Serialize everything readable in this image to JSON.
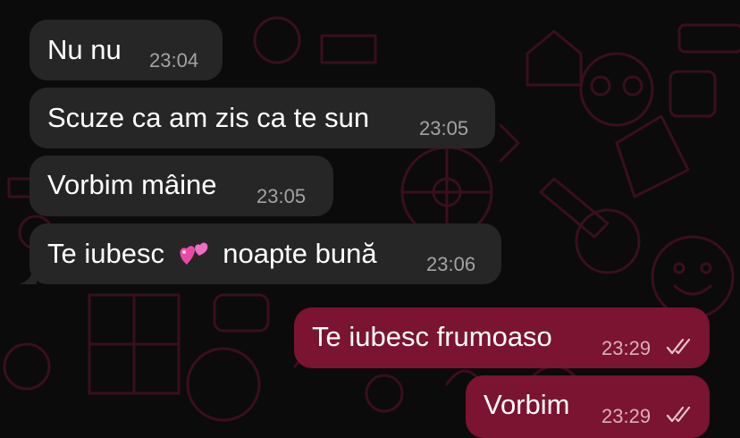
{
  "chat": {
    "incoming": [
      {
        "text": "Nu nu",
        "time": "23:04"
      },
      {
        "text": "Scuze ca am zis ca te sun",
        "time": "23:05"
      },
      {
        "text": "Vorbim mâine",
        "time": "23:05"
      },
      {
        "text_before": "Te iubesc",
        "emoji": "two-hearts",
        "text_after": "noapte bună",
        "time": "23:06"
      }
    ],
    "outgoing": [
      {
        "text": "Te iubesc frumoaso",
        "time": "23:29",
        "status": "read"
      },
      {
        "text": "Vorbim",
        "time": "23:29",
        "status": "read"
      }
    ]
  },
  "colors": {
    "background": "#0b0b0b",
    "incoming_bubble": "#262626",
    "outgoing_bubble": "#7a1430",
    "timestamp": "#a3a3a3",
    "wallpaper_doodle": "#3a0f1d"
  }
}
